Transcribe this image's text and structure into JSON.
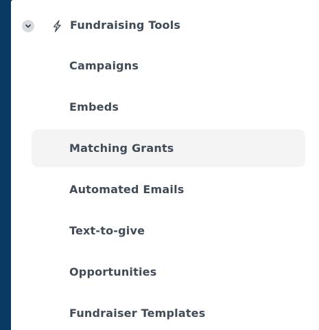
{
  "section": {
    "title": "Fundraising Tools",
    "chevron_icon": "chevron-down-icon",
    "section_icon": "lightning-bolt-icon"
  },
  "nav": {
    "items": [
      {
        "label": "Campaigns"
      },
      {
        "label": "Embeds"
      },
      {
        "label": "Matching Grants"
      },
      {
        "label": "Automated Emails"
      },
      {
        "label": "Text-to-give"
      },
      {
        "label": "Opportunities"
      },
      {
        "label": "Fundraiser Templates"
      }
    ],
    "active_label": "Matching Grants"
  },
  "colors": {
    "background": "#083a63",
    "panel": "#ffffff",
    "active_item": "#f4f4f5",
    "text": "#414b57"
  }
}
